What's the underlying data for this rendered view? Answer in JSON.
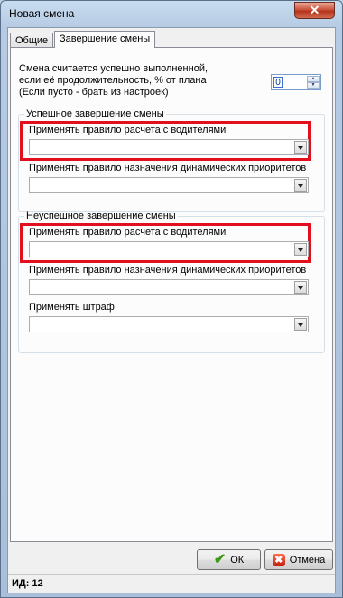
{
  "window": {
    "title": "Новая смена",
    "close_glyph": "✕"
  },
  "tabs": [
    {
      "label": "Общие",
      "active": false
    },
    {
      "label": "Завершение смены",
      "active": true
    }
  ],
  "completion": {
    "desc_line1": "Смена считается успешно выполненной,",
    "desc_line2": "если её продолжительность, % от плана",
    "desc_line3": "(Если пусто - брать из настроек)",
    "percent_value": "0",
    "spin_up_glyph": "▲",
    "spin_down_glyph": "▼"
  },
  "success_group": {
    "legend": "Успешное завершение смены",
    "driver_rule_label": "Применять правило расчета с водителями",
    "driver_rule_value": "",
    "priority_rule_label": "Применять правило назначения динамических приоритетов",
    "priority_rule_value": ""
  },
  "failure_group": {
    "legend": "Неуспешное завершение смены",
    "driver_rule_label": "Применять правило расчета с водителями",
    "driver_rule_value": "",
    "priority_rule_label": "Применять правило назначения динамических приоритетов",
    "priority_rule_value": "",
    "penalty_label": "Применять штраф",
    "penalty_value": ""
  },
  "buttons": {
    "ok_label": "ОК",
    "cancel_label": "Отмена",
    "ok_icon_glyph": "✔",
    "cancel_icon_glyph": "✖"
  },
  "status": {
    "text": "ИД: 12"
  },
  "colors": {
    "highlight": "#e2101c",
    "title_bar": "#b6cbe3"
  }
}
